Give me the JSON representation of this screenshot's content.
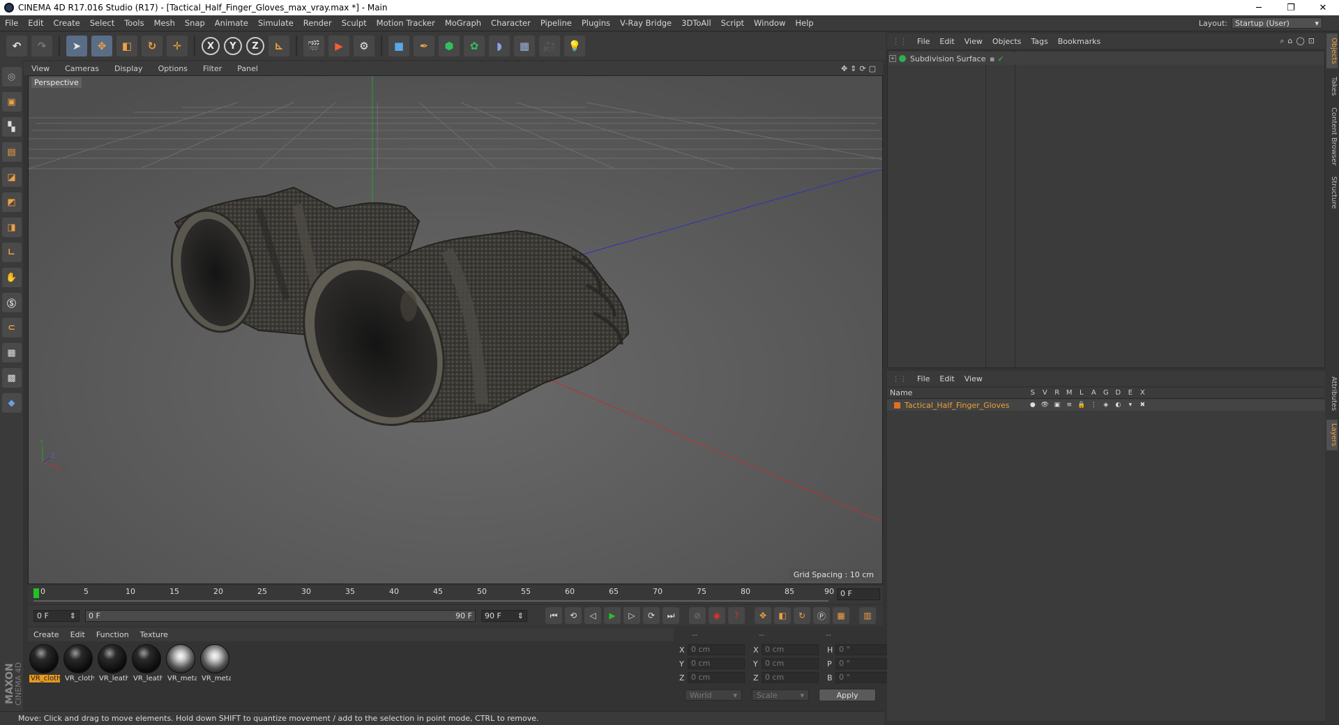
{
  "window": {
    "title": "CINEMA 4D R17.016 Studio (R17) - [Tactical_Half_Finger_Gloves_max_vray.max *] - Main",
    "controls": [
      "─",
      "❐",
      "✕"
    ]
  },
  "menu": {
    "items": [
      "File",
      "Edit",
      "Create",
      "Select",
      "Tools",
      "Mesh",
      "Snap",
      "Animate",
      "Simulate",
      "Render",
      "Sculpt",
      "Motion Tracker",
      "MoGraph",
      "Character",
      "Pipeline",
      "Plugins",
      "V-Ray Bridge",
      "3DToAll",
      "Script",
      "Window",
      "Help"
    ],
    "layout_label": "Layout:",
    "layout_value": "Startup (User)"
  },
  "toolbar": {
    "axis_x": "X",
    "axis_y": "Y",
    "axis_z": "Z",
    "icons": [
      "undo-icon",
      "redo-icon",
      "select-arrow-icon",
      "move-icon",
      "scale-icon",
      "rotate-icon",
      "live-select-icon",
      "axis-x-icon",
      "axis-y-icon",
      "axis-z-icon",
      "coordinate-system-icon",
      "render-view-icon",
      "render-picture-viewer-icon",
      "edit-render-settings-icon",
      "cube-icon",
      "pen-icon",
      "subdivision-icon",
      "mograph-cloner-icon",
      "deformer-icon",
      "floor-icon",
      "camera-icon",
      "light-icon"
    ]
  },
  "viewport": {
    "menu": [
      "View",
      "Cameras",
      "Display",
      "Options",
      "Filter",
      "Panel"
    ],
    "label": "Perspective",
    "grid_spacing": "Grid Spacing : 10 cm",
    "colors": {
      "background": "#5a5a5a",
      "y_axis": "#28a028",
      "x_axis": "#c03030",
      "z_axis": "#3030c0"
    }
  },
  "timeline": {
    "ticks": [
      "0",
      "5",
      "10",
      "15",
      "20",
      "25",
      "30",
      "35",
      "40",
      "45",
      "50",
      "55",
      "60",
      "65",
      "70",
      "75",
      "80",
      "85",
      "90"
    ],
    "current_frame": "0 F",
    "start_field": "0 F",
    "range_start": "0 F",
    "range_end": "90 F",
    "end_field": "90 F"
  },
  "materials": {
    "menu": [
      "Create",
      "Edit",
      "Function",
      "Texture"
    ],
    "items": [
      {
        "label": "VR_cloth",
        "kind": "cloth",
        "selected": true
      },
      {
        "label": "VR_cloth",
        "kind": "cloth",
        "selected": false
      },
      {
        "label": "VR_leath",
        "kind": "leather",
        "selected": false
      },
      {
        "label": "VR_leath",
        "kind": "leather",
        "selected": false
      },
      {
        "label": "VR_meta",
        "kind": "metal",
        "selected": false
      },
      {
        "label": "VR_meta",
        "kind": "metal",
        "selected": false
      }
    ]
  },
  "coordinates": {
    "header": [
      "--",
      "--",
      "--"
    ],
    "rows": [
      {
        "l1": "X",
        "v1": "0 cm",
        "l2": "X",
        "v2": "0 cm",
        "l3": "H",
        "v3": "0 °"
      },
      {
        "l1": "Y",
        "v1": "0 cm",
        "l2": "Y",
        "v2": "0 cm",
        "l3": "P",
        "v3": "0 °"
      },
      {
        "l1": "Z",
        "v1": "0 cm",
        "l2": "Z",
        "v2": "0 cm",
        "l3": "B",
        "v3": "0 °"
      }
    ],
    "mode": "World",
    "transform": "Scale",
    "apply": "Apply"
  },
  "status": "Move: Click and drag to move elements. Hold down SHIFT to quantize movement / add to the selection in point mode, CTRL to remove.",
  "objects": {
    "menu": [
      "File",
      "Edit",
      "View",
      "Objects",
      "Tags",
      "Bookmarks"
    ],
    "items": [
      {
        "name": "Subdivision Surface"
      }
    ]
  },
  "layers": {
    "menu": [
      "File",
      "Edit",
      "View"
    ],
    "header": {
      "name": "Name",
      "cols": [
        "S",
        "V",
        "R",
        "M",
        "L",
        "A",
        "G",
        "D",
        "E",
        "X"
      ]
    },
    "rows": [
      {
        "name": "Tactical_Half_Finger_Gloves",
        "color": "#e07020"
      }
    ]
  },
  "side_tabs": [
    "Objects",
    "Takes",
    "Content Browser",
    "Structure",
    "Attributes",
    "Layers"
  ],
  "branding": {
    "maxon": "MAXON",
    "product": "CINEMA 4D"
  }
}
